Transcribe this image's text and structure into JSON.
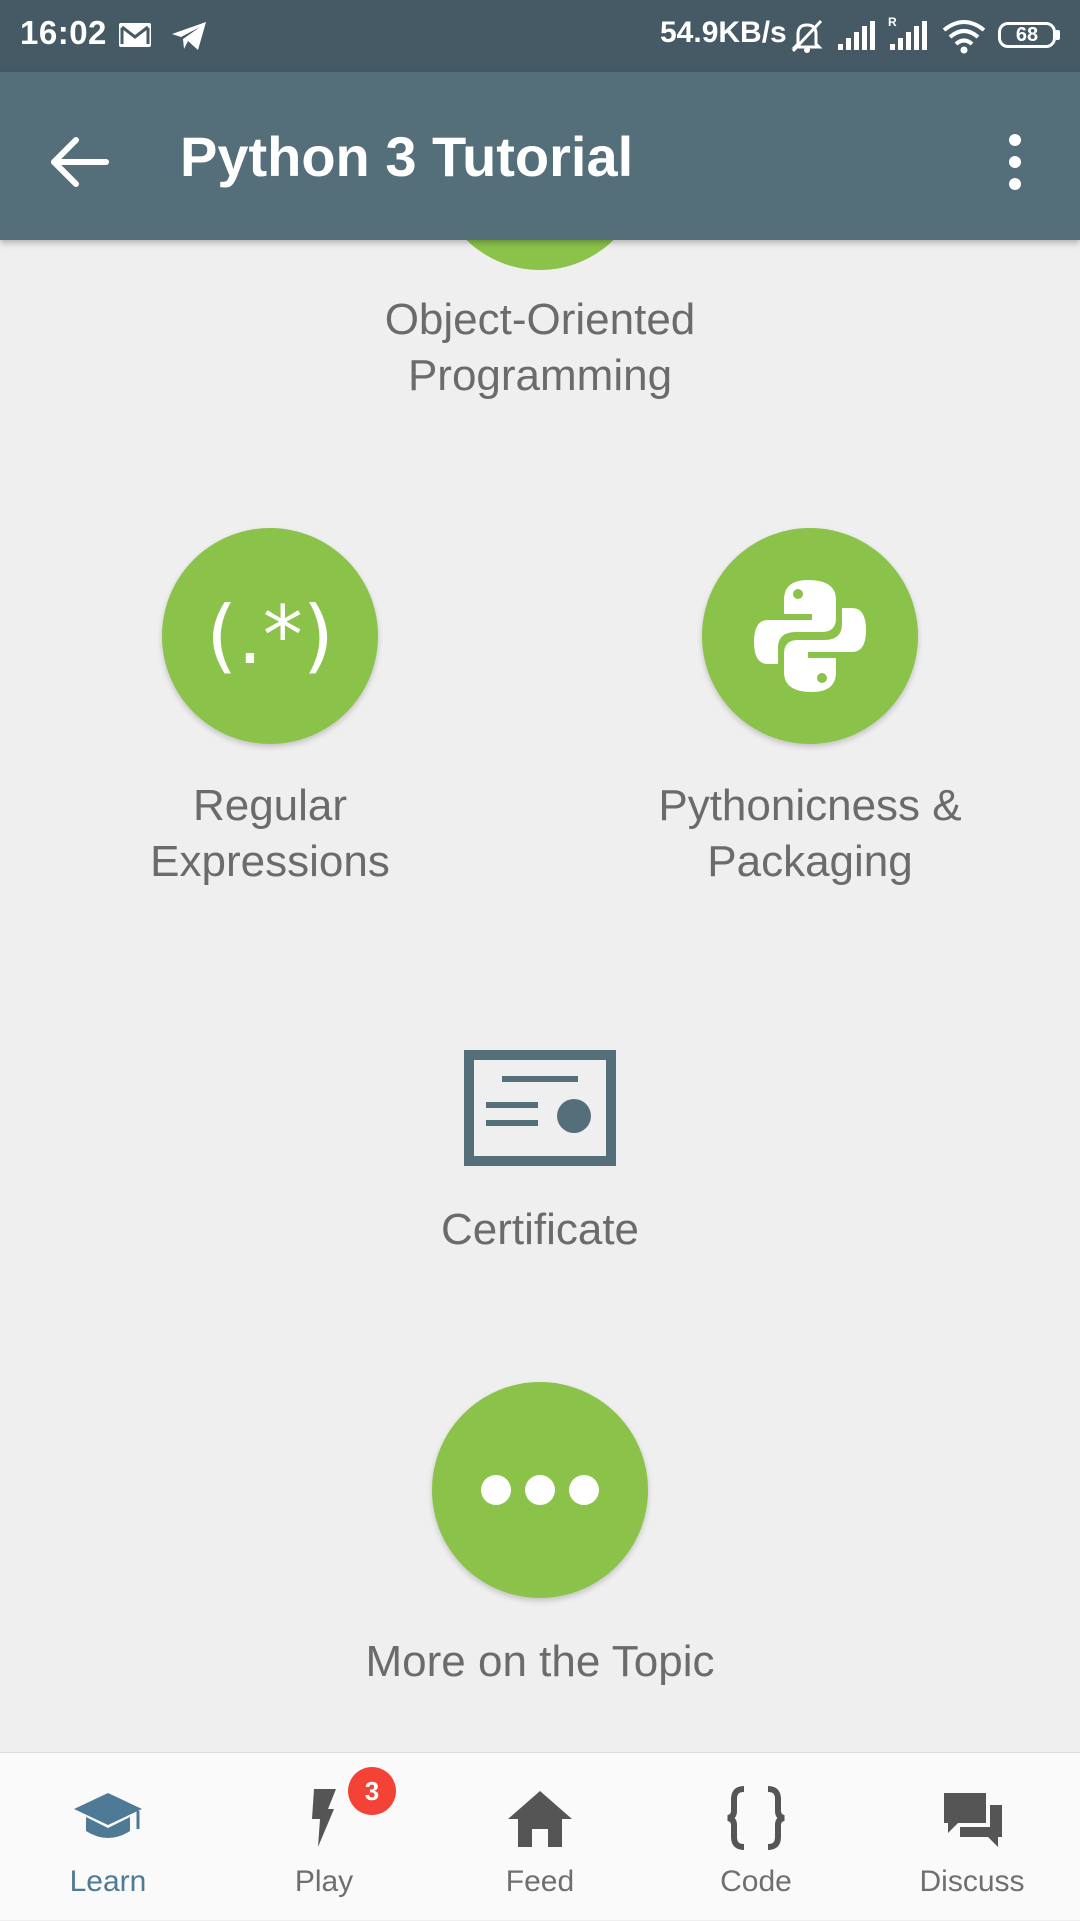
{
  "status_bar": {
    "time": "16:02",
    "network_speed": "54.9KB/s",
    "battery": "68",
    "icons": [
      "mail-icon",
      "telegram-icon",
      "mute-icon",
      "signal-icon",
      "signal-roaming-icon",
      "wifi-icon",
      "battery-icon"
    ]
  },
  "app_bar": {
    "title": "Python 3 Tutorial",
    "back_icon": "arrow-left-icon",
    "menu_icon": "more-vert-icon"
  },
  "lessons": [
    {
      "label_line1": "Object-Oriented",
      "label_line2": "Programming"
    },
    {
      "label_line1": "Regular",
      "label_line2": "Expressions",
      "icon_text": "(.*)"
    },
    {
      "label_line1": "Pythonicness &",
      "label_line2": "Packaging",
      "icon": "python-logo-icon"
    }
  ],
  "certificate": {
    "label": "Certificate",
    "icon": "certificate-icon"
  },
  "more_topic": {
    "label": "More on the Topic",
    "icon": "more-horiz-icon"
  },
  "colors": {
    "status_bar": "#455a64",
    "app_bar": "#546e7a",
    "lesson_green": "#8bc34a",
    "badge_red": "#f44336",
    "active_nav": "#4f7a95"
  },
  "bottom_nav": {
    "items": [
      {
        "label": "Learn",
        "icon": "graduation-cap-icon",
        "active": true
      },
      {
        "label": "Play",
        "icon": "lightning-icon",
        "badge": "3"
      },
      {
        "label": "Feed",
        "icon": "home-icon"
      },
      {
        "label": "Code",
        "icon": "code-braces-icon"
      },
      {
        "label": "Discuss",
        "icon": "chat-icon"
      }
    ]
  }
}
